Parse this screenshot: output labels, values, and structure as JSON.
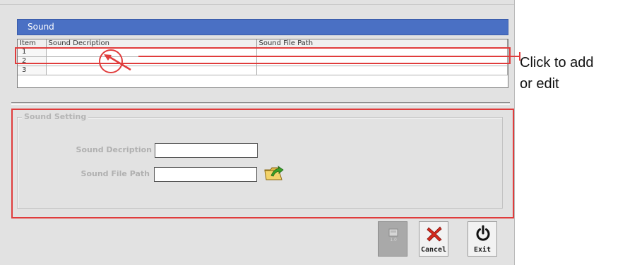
{
  "panel": {
    "title": "Sound"
  },
  "table": {
    "headers": [
      "Item",
      "Sound Decription",
      "Sound File Path"
    ],
    "rows": [
      [
        "1",
        "",
        ""
      ],
      [
        "2",
        "",
        ""
      ],
      [
        "3",
        "",
        ""
      ]
    ]
  },
  "settings": {
    "legend": "Sound Setting",
    "description_label": "Sound Decription",
    "description_value": "",
    "path_label": "Sound File Path",
    "path_value": ""
  },
  "toolbar": {
    "cancel_label": "Cancel",
    "exit_label": "Exit"
  },
  "annotation": {
    "line1": "Click to add",
    "line2": "or edit",
    "highlight_color": "#e03c3c"
  }
}
